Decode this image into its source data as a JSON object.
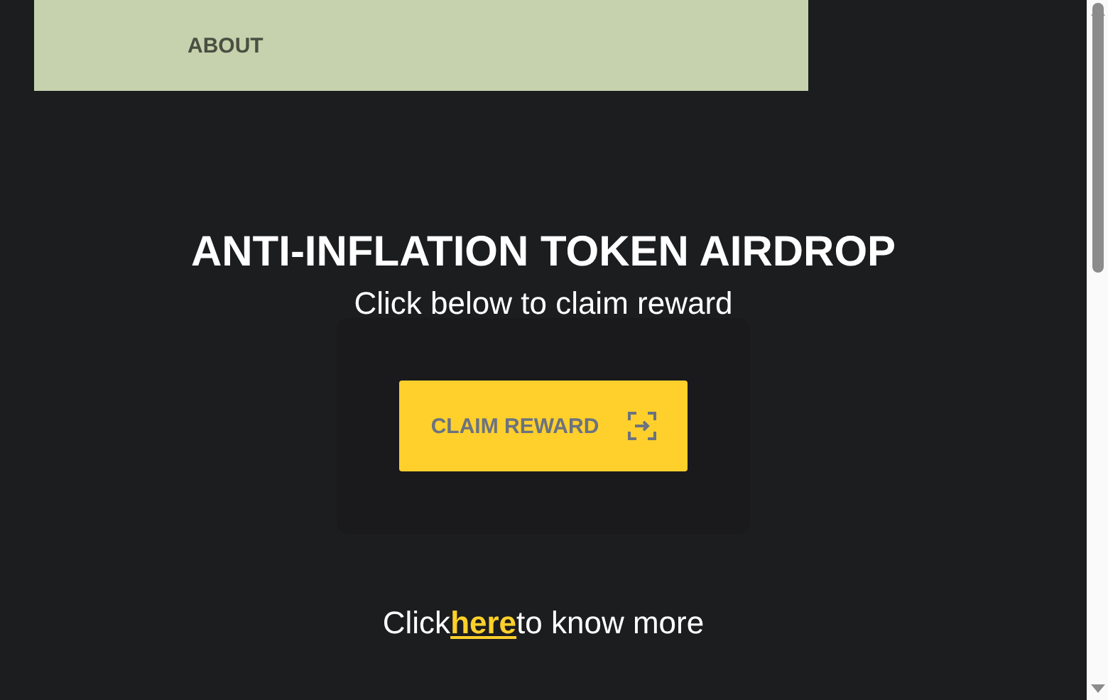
{
  "nav": {
    "items": [
      "ABOUT"
    ]
  },
  "hero": {
    "title": "ANTI-INFLATION TOKEN AIRDROP",
    "subtitle": "Click below to claim reward",
    "button": "CLAIM REWARD"
  },
  "footer_line": {
    "before": "Click",
    "link": "here",
    "after": "to know more"
  }
}
